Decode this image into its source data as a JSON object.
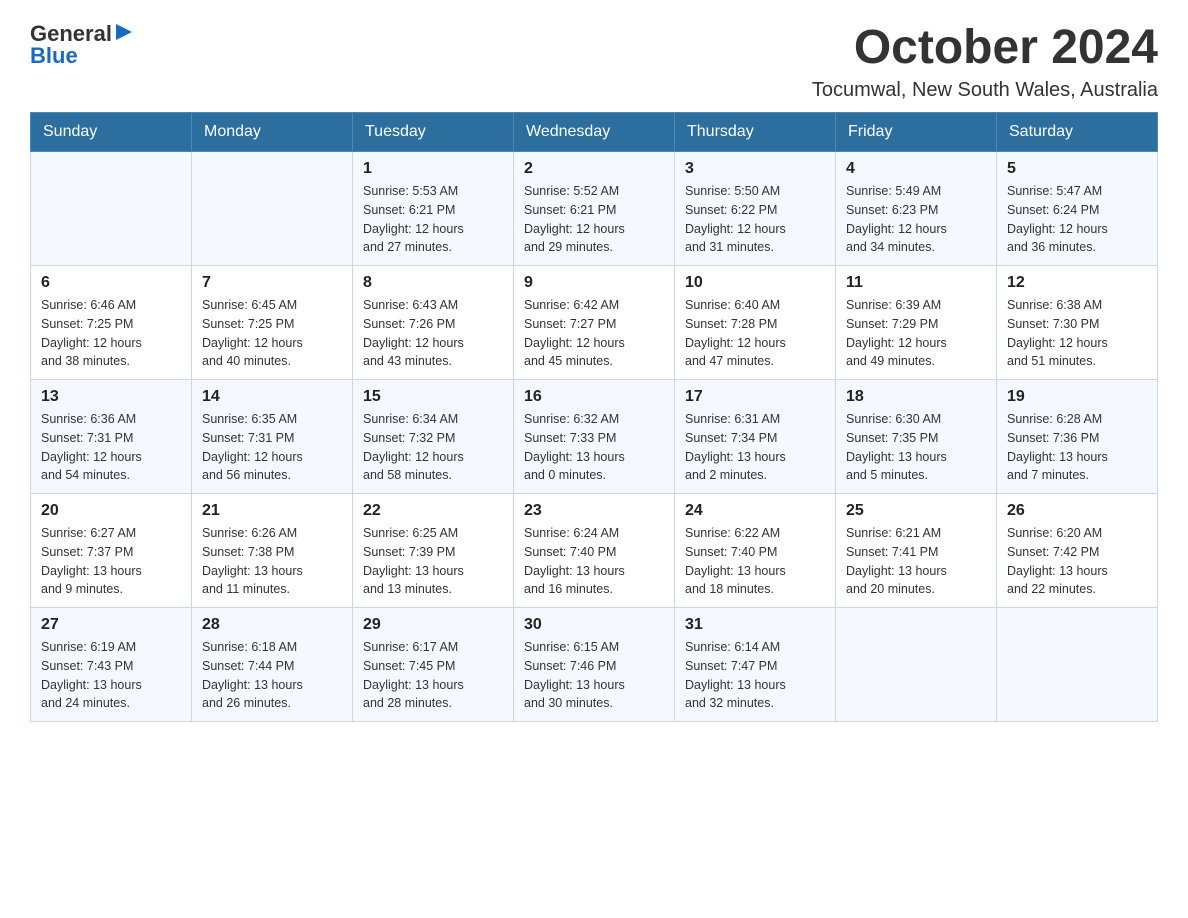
{
  "header": {
    "logo_general": "General",
    "logo_blue": "Blue",
    "month": "October 2024",
    "location": "Tocumwal, New South Wales, Australia"
  },
  "weekdays": [
    "Sunday",
    "Monday",
    "Tuesday",
    "Wednesday",
    "Thursday",
    "Friday",
    "Saturday"
  ],
  "weeks": [
    [
      {
        "day": "",
        "info": ""
      },
      {
        "day": "",
        "info": ""
      },
      {
        "day": "1",
        "info": "Sunrise: 5:53 AM\nSunset: 6:21 PM\nDaylight: 12 hours\nand 27 minutes."
      },
      {
        "day": "2",
        "info": "Sunrise: 5:52 AM\nSunset: 6:21 PM\nDaylight: 12 hours\nand 29 minutes."
      },
      {
        "day": "3",
        "info": "Sunrise: 5:50 AM\nSunset: 6:22 PM\nDaylight: 12 hours\nand 31 minutes."
      },
      {
        "day": "4",
        "info": "Sunrise: 5:49 AM\nSunset: 6:23 PM\nDaylight: 12 hours\nand 34 minutes."
      },
      {
        "day": "5",
        "info": "Sunrise: 5:47 AM\nSunset: 6:24 PM\nDaylight: 12 hours\nand 36 minutes."
      }
    ],
    [
      {
        "day": "6",
        "info": "Sunrise: 6:46 AM\nSunset: 7:25 PM\nDaylight: 12 hours\nand 38 minutes."
      },
      {
        "day": "7",
        "info": "Sunrise: 6:45 AM\nSunset: 7:25 PM\nDaylight: 12 hours\nand 40 minutes."
      },
      {
        "day": "8",
        "info": "Sunrise: 6:43 AM\nSunset: 7:26 PM\nDaylight: 12 hours\nand 43 minutes."
      },
      {
        "day": "9",
        "info": "Sunrise: 6:42 AM\nSunset: 7:27 PM\nDaylight: 12 hours\nand 45 minutes."
      },
      {
        "day": "10",
        "info": "Sunrise: 6:40 AM\nSunset: 7:28 PM\nDaylight: 12 hours\nand 47 minutes."
      },
      {
        "day": "11",
        "info": "Sunrise: 6:39 AM\nSunset: 7:29 PM\nDaylight: 12 hours\nand 49 minutes."
      },
      {
        "day": "12",
        "info": "Sunrise: 6:38 AM\nSunset: 7:30 PM\nDaylight: 12 hours\nand 51 minutes."
      }
    ],
    [
      {
        "day": "13",
        "info": "Sunrise: 6:36 AM\nSunset: 7:31 PM\nDaylight: 12 hours\nand 54 minutes."
      },
      {
        "day": "14",
        "info": "Sunrise: 6:35 AM\nSunset: 7:31 PM\nDaylight: 12 hours\nand 56 minutes."
      },
      {
        "day": "15",
        "info": "Sunrise: 6:34 AM\nSunset: 7:32 PM\nDaylight: 12 hours\nand 58 minutes."
      },
      {
        "day": "16",
        "info": "Sunrise: 6:32 AM\nSunset: 7:33 PM\nDaylight: 13 hours\nand 0 minutes."
      },
      {
        "day": "17",
        "info": "Sunrise: 6:31 AM\nSunset: 7:34 PM\nDaylight: 13 hours\nand 2 minutes."
      },
      {
        "day": "18",
        "info": "Sunrise: 6:30 AM\nSunset: 7:35 PM\nDaylight: 13 hours\nand 5 minutes."
      },
      {
        "day": "19",
        "info": "Sunrise: 6:28 AM\nSunset: 7:36 PM\nDaylight: 13 hours\nand 7 minutes."
      }
    ],
    [
      {
        "day": "20",
        "info": "Sunrise: 6:27 AM\nSunset: 7:37 PM\nDaylight: 13 hours\nand 9 minutes."
      },
      {
        "day": "21",
        "info": "Sunrise: 6:26 AM\nSunset: 7:38 PM\nDaylight: 13 hours\nand 11 minutes."
      },
      {
        "day": "22",
        "info": "Sunrise: 6:25 AM\nSunset: 7:39 PM\nDaylight: 13 hours\nand 13 minutes."
      },
      {
        "day": "23",
        "info": "Sunrise: 6:24 AM\nSunset: 7:40 PM\nDaylight: 13 hours\nand 16 minutes."
      },
      {
        "day": "24",
        "info": "Sunrise: 6:22 AM\nSunset: 7:40 PM\nDaylight: 13 hours\nand 18 minutes."
      },
      {
        "day": "25",
        "info": "Sunrise: 6:21 AM\nSunset: 7:41 PM\nDaylight: 13 hours\nand 20 minutes."
      },
      {
        "day": "26",
        "info": "Sunrise: 6:20 AM\nSunset: 7:42 PM\nDaylight: 13 hours\nand 22 minutes."
      }
    ],
    [
      {
        "day": "27",
        "info": "Sunrise: 6:19 AM\nSunset: 7:43 PM\nDaylight: 13 hours\nand 24 minutes."
      },
      {
        "day": "28",
        "info": "Sunrise: 6:18 AM\nSunset: 7:44 PM\nDaylight: 13 hours\nand 26 minutes."
      },
      {
        "day": "29",
        "info": "Sunrise: 6:17 AM\nSunset: 7:45 PM\nDaylight: 13 hours\nand 28 minutes."
      },
      {
        "day": "30",
        "info": "Sunrise: 6:15 AM\nSunset: 7:46 PM\nDaylight: 13 hours\nand 30 minutes."
      },
      {
        "day": "31",
        "info": "Sunrise: 6:14 AM\nSunset: 7:47 PM\nDaylight: 13 hours\nand 32 minutes."
      },
      {
        "day": "",
        "info": ""
      },
      {
        "day": "",
        "info": ""
      }
    ]
  ]
}
